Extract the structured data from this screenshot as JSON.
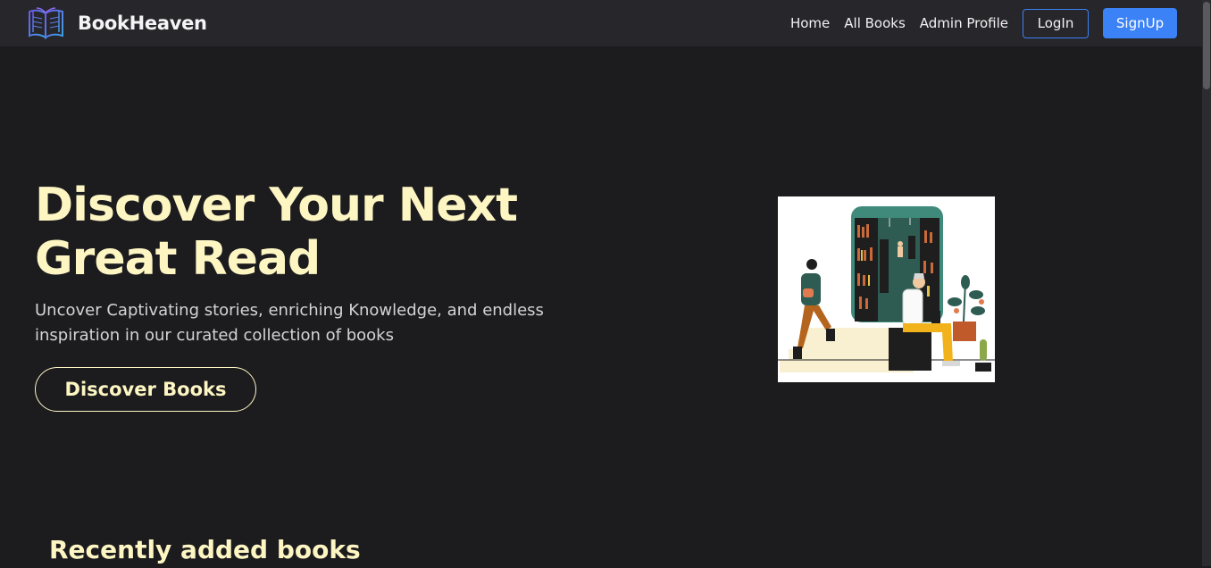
{
  "brand": {
    "name": "BookHeaven",
    "logo_icon": "open-book-icon"
  },
  "nav": {
    "links": [
      "Home",
      "All Books",
      "Admin Profile"
    ],
    "login_label": "LogIn",
    "signup_label": "SignUp"
  },
  "hero": {
    "title_line1": "Discover Your Next",
    "title_line2": "Great Read",
    "subtitle_line1": "Uncover Captivating stories, enriching Knowledge, and endless",
    "subtitle_line2": "inspiration in our curated collection of books",
    "cta_label": "Discover Books",
    "illustration": "reading-people-illustration"
  },
  "recent": {
    "heading": "Recently added books"
  },
  "colors": {
    "background": "#1c1b1e",
    "navbar": "#27262a",
    "accent_cream": "#fdf6c3",
    "primary_blue": "#3b82f6"
  }
}
